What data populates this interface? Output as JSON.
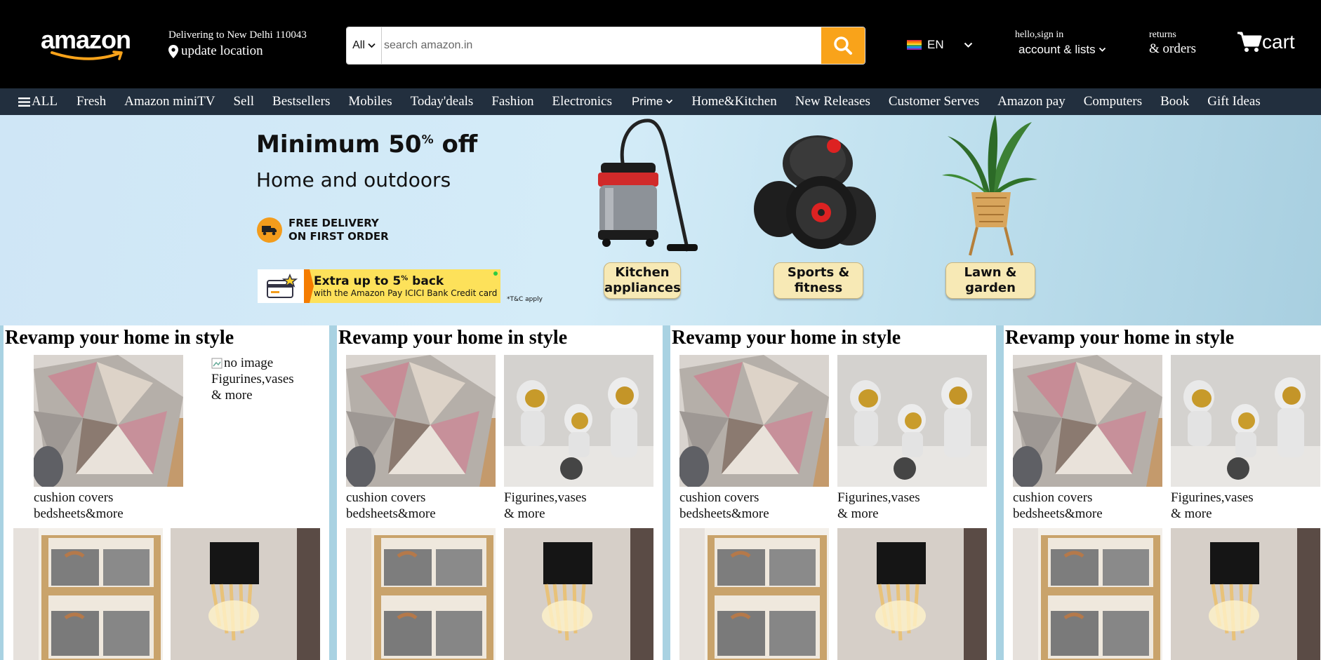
{
  "header": {
    "logo": "amazon",
    "deliver_line1": "Delivering to New Delhi 110043",
    "deliver_line2": "update location",
    "search_category": "All",
    "search_placeholder": "search amazon.in",
    "language": "EN",
    "account_line1": "hello,sign in",
    "account_line2": "account & lists",
    "returns_line1": "returns",
    "returns_line2": "& orders",
    "cart_label": "cart"
  },
  "nav": {
    "all": "ALL",
    "items": [
      "Fresh",
      "Amazon miniTV",
      "Sell",
      "Bestsellers",
      "Mobiles",
      "Today'deals",
      "Fashion",
      "Electronics",
      "Prime",
      "Home&Kitchen",
      "New Releases",
      "Customer Serves",
      "Amazon pay",
      "Computers",
      "Book",
      "Gift Ideas"
    ]
  },
  "hero": {
    "title": "Minimum 50",
    "title_sup": "%",
    "title_tail": " off",
    "subtitle": "Home and outdoors",
    "delivery_line1": "FREE DELIVERY",
    "delivery_line2": "ON FIRST ORDER",
    "cashback_title": "Extra up to 5",
    "cashback_sup": "%",
    "cashback_tail": " back",
    "cashback_sub": "with the Amazon Pay ICICI Bank Credit card",
    "tc": "*T&C apply",
    "categories": [
      {
        "line1": "Kitchen",
        "line2": "appliances"
      },
      {
        "line1": "Sports &",
        "line2": "fitness"
      },
      {
        "line1": "Lawn &",
        "line2": "garden"
      }
    ]
  },
  "cards": [
    {
      "title": "Revamp your home in style",
      "tile1_line1": "cushion covers",
      "tile1_line2": "bedsheets&more",
      "tile2_broken_alt": "no image",
      "tile2_line1": "Figurines,vases",
      "tile2_line2": "& more"
    },
    {
      "title": "Revamp your home in style",
      "tile1_line1": "cushion covers",
      "tile1_line2": "bedsheets&more",
      "tile2_line1": "Figurines,vases",
      "tile2_line2": "& more"
    },
    {
      "title": "Revamp your home in style",
      "tile1_line1": "cushion covers",
      "tile1_line2": "bedsheets&more",
      "tile2_line1": "Figurines,vases",
      "tile2_line2": "& more"
    },
    {
      "title": "Revamp your home in style",
      "tile1_line1": "cushion covers",
      "tile1_line2": "bedsheets&more",
      "tile2_line1": "Figurines,vases",
      "tile2_line2": "& more"
    }
  ],
  "colors": {
    "header_bg": "#000000",
    "nav_bg": "#222f3e",
    "search_button": "#f9a31a",
    "hero_bg": "#cfe6f6",
    "cards_bg": "#a9d2e2"
  },
  "icons": {
    "search": "search-icon",
    "location": "location-pin-icon",
    "cart": "cart-icon",
    "menu": "hamburger-icon",
    "language_flag": "flag-icon"
  }
}
